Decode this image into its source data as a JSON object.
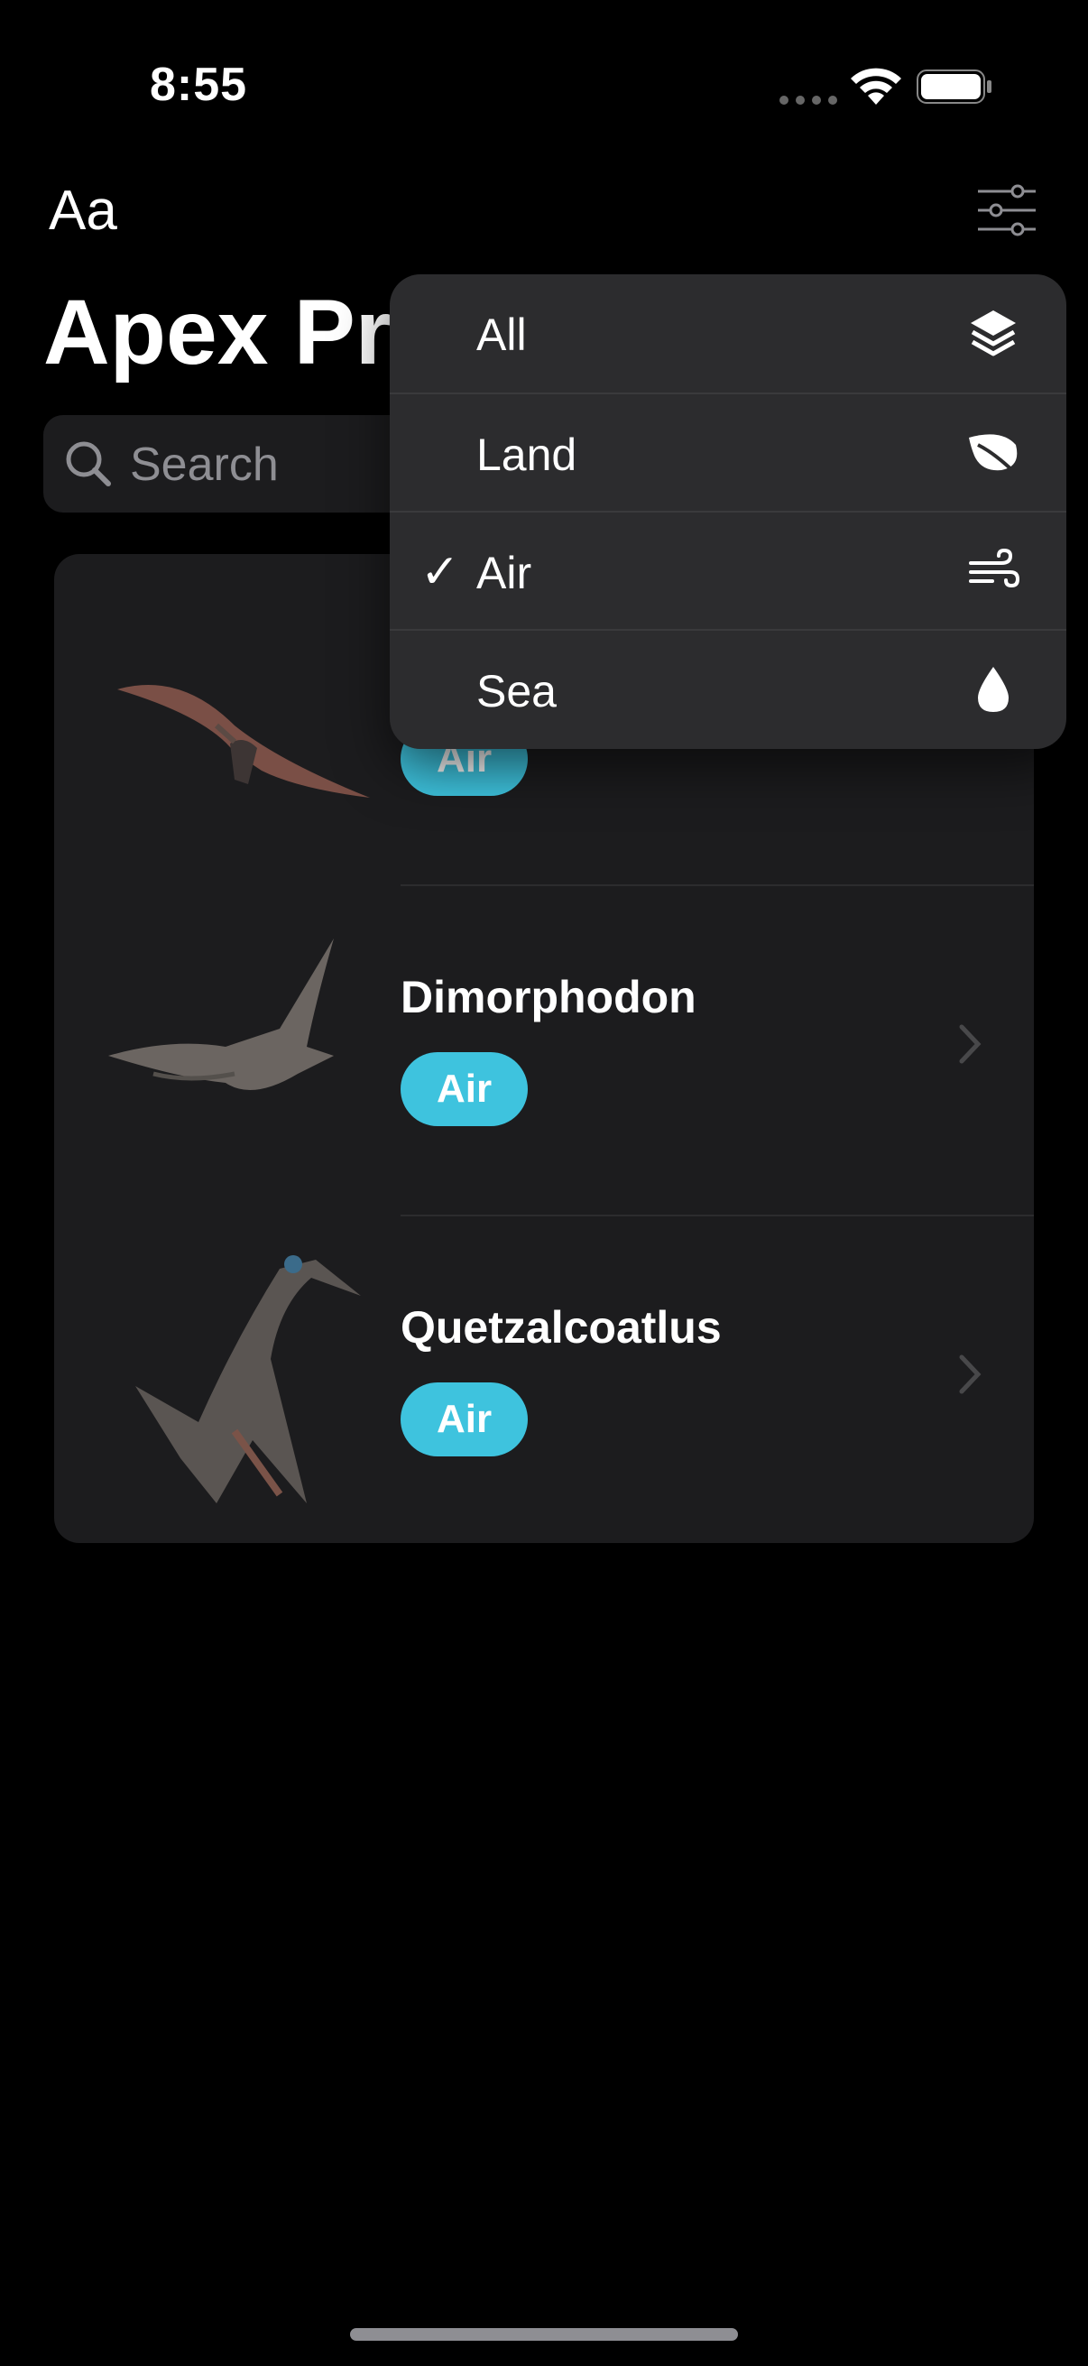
{
  "status_bar": {
    "time": "8:55"
  },
  "nav": {
    "font_button_label": "Aa",
    "title": "Apex Predators"
  },
  "search": {
    "placeholder": "Search"
  },
  "list": [
    {
      "name": "",
      "badge": "Air"
    },
    {
      "name": "Dimorphodon",
      "badge": "Air"
    },
    {
      "name": "Quetzalcoatlus",
      "badge": "Air"
    }
  ],
  "filter_menu": {
    "items": [
      {
        "label": "All",
        "icon": "stack-icon",
        "selected": false
      },
      {
        "label": "Land",
        "icon": "leaf-icon",
        "selected": false
      },
      {
        "label": "Air",
        "icon": "wind-icon",
        "selected": true
      },
      {
        "label": "Sea",
        "icon": "drop-icon",
        "selected": false
      }
    ],
    "check_glyph": "✓"
  },
  "colors": {
    "badge_air": "#3ec3de",
    "background": "#000000",
    "card": "#1c1c1e",
    "menu": "#2c2c2e"
  }
}
